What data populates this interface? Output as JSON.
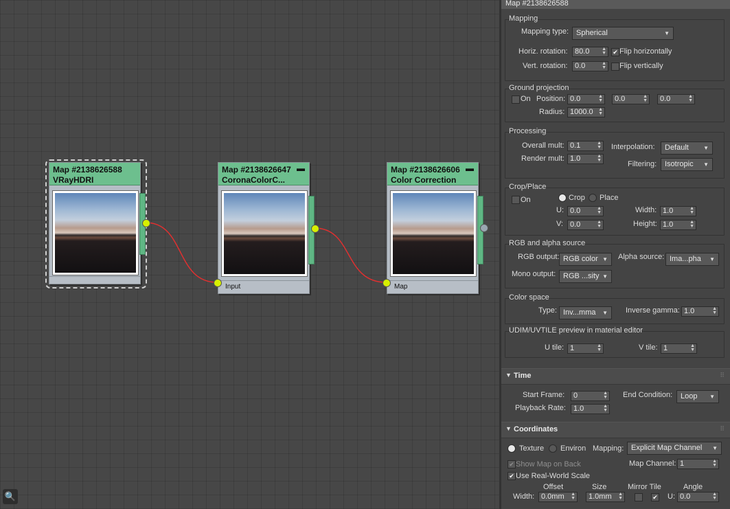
{
  "panel_title": "Map #2138626588",
  "nodes": [
    {
      "title": "Map #2138626588",
      "subtitle": "VRayHDRI",
      "input_label": ""
    },
    {
      "title": "Map #2138626647",
      "subtitle": "CoronaColorC...",
      "input_label": "Input"
    },
    {
      "title": "Map #2138626606",
      "subtitle": "Color Correction",
      "input_label": "Map"
    }
  ],
  "node_minimize_glyph": "▬",
  "mapping": {
    "group": "Mapping",
    "type_label": "Mapping type:",
    "type_value": "Spherical",
    "horiz_label": "Horiz. rotation:",
    "horiz_value": "80.0",
    "vert_label": "Vert. rotation:",
    "vert_value": "0.0",
    "flip_h_label": "Flip horizontally",
    "flip_h": true,
    "flip_v_label": "Flip vertically",
    "flip_v": false
  },
  "ground": {
    "group": "Ground projection",
    "on_label": "On",
    "on": false,
    "position_label": "Position:",
    "pos": [
      "0.0",
      "0.0",
      "0.0"
    ],
    "radius_label": "Radius:",
    "radius": "1000.0"
  },
  "processing": {
    "group": "Processing",
    "overall_label": "Overall mult:",
    "overall": "0.1",
    "render_label": "Render mult:",
    "render": "1.0",
    "interp_label": "Interpolation:",
    "interp": "Default",
    "filter_label": "Filtering:",
    "filter": "Isotropic"
  },
  "crop": {
    "group": "Crop/Place",
    "on_label": "On",
    "crop_label": "Crop",
    "place_label": "Place",
    "u_label": "U:",
    "u": "0.0",
    "v_label": "V:",
    "v": "0.0",
    "width_label": "Width:",
    "width": "1.0",
    "height_label": "Height:",
    "height": "1.0"
  },
  "rgb": {
    "group": "RGB and alpha source",
    "rgb_out_label": "RGB output:",
    "rgb_out": "RGB color",
    "alpha_label": "Alpha source:",
    "alpha": "Ima...pha",
    "mono_label": "Mono output:",
    "mono": "RGB ...sity"
  },
  "colorspace": {
    "group": "Color space",
    "type_label": "Type:",
    "type": "Inv...mma",
    "gamma_label": "Inverse gamma:",
    "gamma": "1.0"
  },
  "udim": {
    "group": "UDIM/UVTILE preview in material editor",
    "u_label": "U tile:",
    "u": "1",
    "v_label": "V tile:",
    "v": "1"
  },
  "time": {
    "title": "Time",
    "start_label": "Start Frame:",
    "start": "0",
    "rate_label": "Playback Rate:",
    "rate": "1.0",
    "end_label": "End Condition:",
    "end": "Loop"
  },
  "coords": {
    "title": "Coordinates",
    "texture_label": "Texture",
    "environ_label": "Environ",
    "mapping_label": "Mapping:",
    "mapping": "Explicit Map Channel",
    "show_back_label": "Show Map on Back",
    "channel_label": "Map Channel:",
    "channel": "1",
    "realworld_label": "Use Real-World Scale",
    "h_offset": "Offset",
    "h_size": "Size",
    "h_mirror": "Mirror Tile",
    "h_angle": "Angle",
    "width_label": "Width:",
    "offset_w": "0.0mm",
    "size_w": "1.0mm",
    "u_label": "U:",
    "angle_u": "0.0"
  },
  "icons": {
    "binoculars": "binoculars-icon"
  },
  "glyphs": {
    "check": "✔",
    "arrow": "▼",
    "spin": "▲▼",
    "collapse": "▼",
    "dots": "⠿",
    "binoc": "🔍"
  },
  "colors": {
    "node_header": "#6dbf8e",
    "port": "#d7f000",
    "wire": "#e03030"
  }
}
